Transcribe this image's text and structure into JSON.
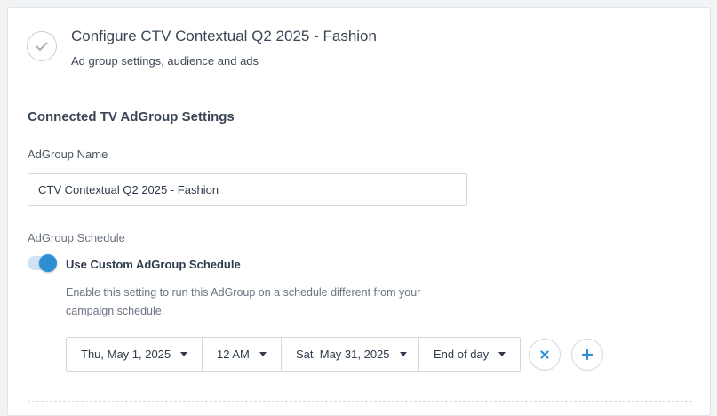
{
  "step": {
    "title": "Configure CTV Contextual Q2 2025 - Fashion",
    "subtitle": "Ad group settings, audience and ads",
    "status_icon": "check-icon"
  },
  "settings": {
    "section_title": "Connected TV AdGroup Settings",
    "name_label": "AdGroup Name",
    "name_value": "CTV Contextual Q2 2025 - Fashion",
    "schedule_label": "AdGroup Schedule",
    "custom_schedule": {
      "enabled": true,
      "label": "Use Custom AdGroup Schedule",
      "help": "Enable this setting to run this AdGroup on a schedule different from your campaign schedule."
    },
    "schedule_range": {
      "start_date": "Thu, May 1, 2025",
      "start_time": "12 AM",
      "end_date": "Sat, May 31, 2025",
      "end_time": "End of day"
    }
  },
  "colors": {
    "accent": "#2f8fd4",
    "toggle_track": "#cfe3f3",
    "text": "#2f3b4a",
    "muted": "#6a7482"
  }
}
